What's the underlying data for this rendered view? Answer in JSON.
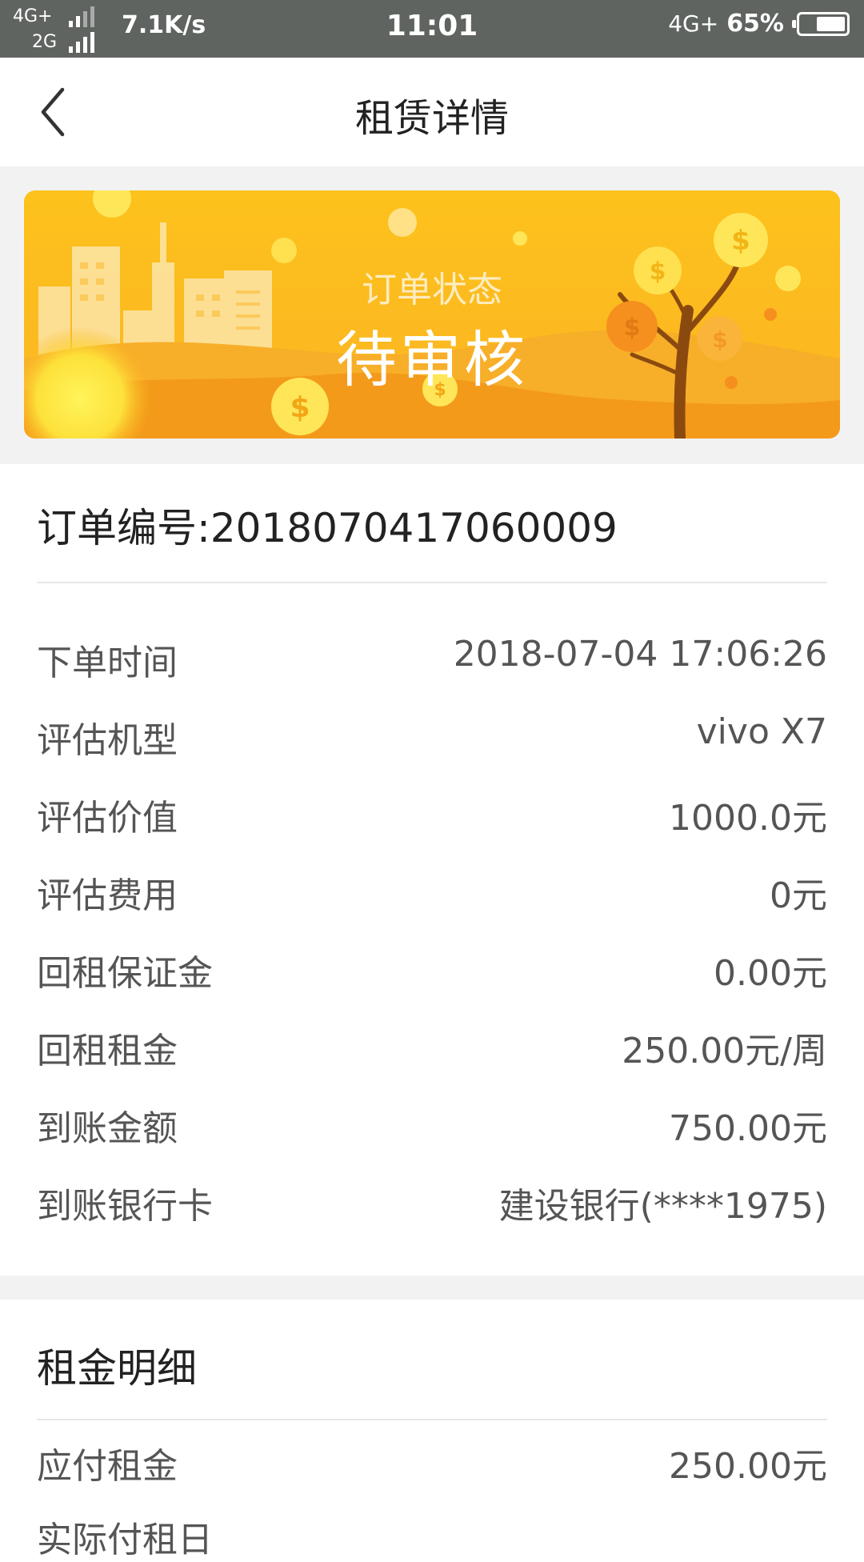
{
  "status_bar": {
    "net_top": "4G+",
    "net_bottom": "2G",
    "speed": "7.1K/s",
    "time": "11:01",
    "net_right": "4G+",
    "battery": "65%",
    "battery_level": 0.65
  },
  "header": {
    "title": "租赁详情",
    "back_icon": "chevron-left-icon"
  },
  "banner": {
    "label": "订单状态",
    "status": "待审核",
    "colors": {
      "sky": "#fcc21f",
      "hill_front": "#f39a1a",
      "hill_back": "#f7ae29",
      "coin": "#ffe14a",
      "trunk": "#8a4a0f"
    }
  },
  "order": {
    "label": "订单编号",
    "separator": ":",
    "number": "2018070417060009"
  },
  "details": [
    {
      "key": "下单时间",
      "value": "2018-07-04 17:06:26"
    },
    {
      "key": "评估机型",
      "value": "vivo X7"
    },
    {
      "key": "评估价值",
      "value": "1000.0元"
    },
    {
      "key": "评估费用",
      "value": "0元"
    },
    {
      "key": "回租保证金",
      "value": "0.00元"
    },
    {
      "key": "回租租金",
      "value": "250.00元/周"
    },
    {
      "key": "到账金额",
      "value": "750.00元"
    },
    {
      "key": "到账银行卡",
      "value": "建设银行(****1975)"
    }
  ],
  "rent_detail": {
    "title": "租金明细",
    "rows": [
      {
        "key": "应付租金",
        "value": "250.00元"
      }
    ],
    "next_label": "实际付租日"
  }
}
